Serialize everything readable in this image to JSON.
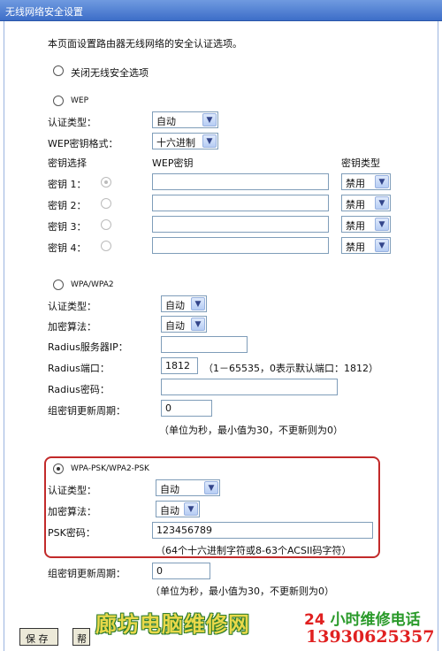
{
  "window": {
    "title": "无线网络安全设置"
  },
  "intro": "本页面设置路由器无线网络的安全认证选项。",
  "option_off": {
    "label": "关闭无线安全选项"
  },
  "wep": {
    "label": "WEP",
    "auth_label": "认证类型：",
    "auth_value": "自动",
    "format_label": "WEP密钥格式：",
    "format_value": "十六进制",
    "col_select": "密钥选择",
    "col_key": "WEP密钥",
    "col_type": "密钥类型",
    "keys": [
      {
        "label": "密钥 1：",
        "type": "禁用"
      },
      {
        "label": "密钥 2：",
        "type": "禁用"
      },
      {
        "label": "密钥 3：",
        "type": "禁用"
      },
      {
        "label": "密钥 4：",
        "type": "禁用"
      }
    ]
  },
  "wpa": {
    "label": "WPA/WPA2",
    "auth_label": "认证类型：",
    "auth_value": "自动",
    "algo_label": "加密算法：",
    "algo_value": "自动",
    "radius_ip_label": "Radius服务器IP：",
    "radius_ip_value": "",
    "radius_port_label": "Radius端口：",
    "radius_port_value": "1812",
    "radius_port_hint": "（1－65535，0表示默认端口：1812）",
    "radius_pwd_label": "Radius密码：",
    "radius_pwd_value": "",
    "rekey_label": "组密钥更新周期：",
    "rekey_value": "0",
    "rekey_hint": "（单位为秒，最小值为30，不更新则为0）"
  },
  "psk": {
    "label": "WPA-PSK/WPA2-PSK",
    "auth_label": "认证类型：",
    "auth_value": "自动",
    "algo_label": "加密算法：",
    "algo_value": "自动",
    "pwd_label": "PSK密码：",
    "pwd_value": "123456789",
    "pwd_hint": "（64个十六进制字符或8-63个ACSII码字符）",
    "rekey_label": "组密钥更新周期：",
    "rekey_value": "0",
    "rekey_hint": "（单位为秒，最小值为30，不更新则为0）"
  },
  "buttons": {
    "save": "保 存",
    "help": "帮"
  },
  "watermark": {
    "left": "廊坊电脑维修网",
    "right_top_num": "24",
    "right_top_text": " 小时维修电话",
    "phone": "13930625357"
  },
  "icons": {
    "arrow": "chevron-down-icon"
  },
  "colors": {
    "highlight_border": "#c22a2a",
    "title_bar": "#3d6ec8"
  }
}
